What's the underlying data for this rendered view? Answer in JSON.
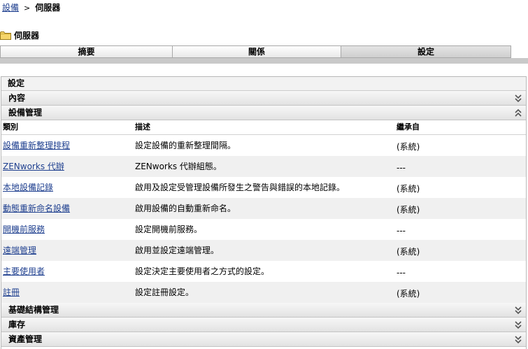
{
  "breadcrumb": {
    "parent": "設備",
    "separator": ">",
    "current": "伺服器"
  },
  "page_title": "伺服器",
  "tabs": [
    {
      "label": "摘要",
      "active": false
    },
    {
      "label": "關係",
      "active": false
    },
    {
      "label": "設定",
      "active": true
    }
  ],
  "panel": {
    "title": "設定"
  },
  "sections": {
    "content": "內容",
    "device_mgmt": "設備管理",
    "infrastructure": "基礎結構管理",
    "inventory": "庫存",
    "asset": "資產管理"
  },
  "columns": {
    "category": "類別",
    "description": "描述",
    "inherited": "繼承自"
  },
  "rows": [
    {
      "category": "設備重新整理排程",
      "description": "設定設備的重新整理間隔。",
      "inherited": "(系統)"
    },
    {
      "category": "ZENworks 代辦",
      "description": "ZENworks 代辦組態。",
      "inherited": "---"
    },
    {
      "category": "本地設備記錄",
      "description": "啟用及設定受管理設備所發生之警告與錯誤的本地記錄。",
      "inherited": "(系統)"
    },
    {
      "category": "動態重新命名設備",
      "description": "啟用設備的自動重新命名。",
      "inherited": "(系統)"
    },
    {
      "category": "開機前服務",
      "description": "設定開機前服務。",
      "inherited": "---"
    },
    {
      "category": "遠端管理",
      "description": "啟用並設定遠端管理。",
      "inherited": "(系統)"
    },
    {
      "category": "主要使用者",
      "description": "設定決定主要使用者之方式的設定。",
      "inherited": "---"
    },
    {
      "category": "註冊",
      "description": "設定註冊設定。",
      "inherited": "(系統)"
    }
  ],
  "icons": {
    "expand": "chevron-double-down-icon",
    "collapse": "chevron-double-up-icon",
    "folder": "folder-icon"
  }
}
